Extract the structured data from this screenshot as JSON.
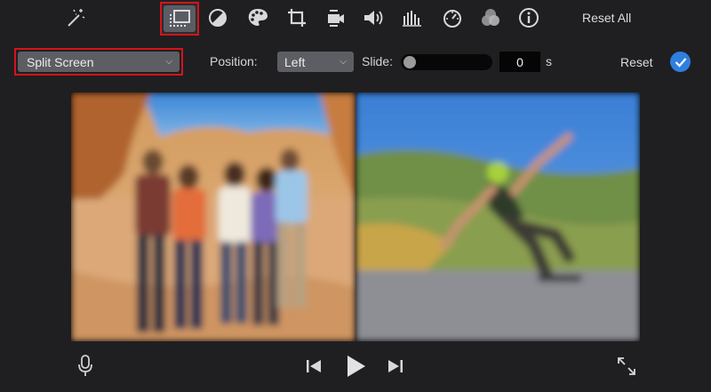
{
  "toolbar": {
    "icons": [
      "magic-wand-icon",
      "video-overlay-icon",
      "color-balance-icon",
      "color-palette-icon",
      "crop-icon",
      "camera-stabilization-icon",
      "volume-icon",
      "equalizer-icon",
      "speed-icon",
      "clip-filter-icon",
      "info-icon"
    ],
    "selected": "video-overlay-icon",
    "reset_all_label": "Reset All"
  },
  "overlay_settings": {
    "style_value": "Split Screen",
    "position_label": "Position:",
    "position_value": "Left",
    "slide_label": "Slide:",
    "slide_value": "0",
    "slide_unit": "s",
    "slider_level": 0,
    "reset_label": "Reset"
  },
  "colors": {
    "highlight": "#d4141b",
    "accent": "#2f7fe0",
    "background": "#1f1f21"
  },
  "playback": {
    "icons": [
      "microphone-icon",
      "skip-back-icon",
      "play-icon",
      "skip-forward-icon",
      "fullscreen-icon"
    ]
  }
}
